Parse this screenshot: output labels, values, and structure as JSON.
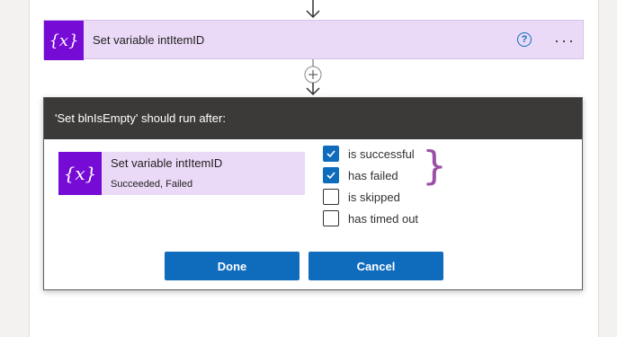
{
  "action_card": {
    "icon": "variable-icon",
    "icon_text": "{x}",
    "title": "Set variable intItemID",
    "help_icon": "question-circle-icon",
    "help_text": "?",
    "more_icon": "more-dots-icon",
    "more_text": "···"
  },
  "connector": {
    "icon": "add-step-icon"
  },
  "dialog": {
    "title": "'Set blnIsEmpty' should run after:",
    "previous_action": {
      "icon": "variable-icon",
      "icon_text": "{x}",
      "name": "Set variable intItemID",
      "status": "Succeeded, Failed"
    },
    "options": [
      {
        "label": "is successful",
        "checked": true
      },
      {
        "label": "has failed",
        "checked": true
      },
      {
        "label": "is skipped",
        "checked": false
      },
      {
        "label": "has timed out",
        "checked": false
      }
    ],
    "annotation": "}",
    "done_label": "Done",
    "cancel_label": "Cancel"
  },
  "colors": {
    "accent": "#0f6cbd",
    "variable_purple": "#770bd6",
    "card_background": "#eadaf7",
    "header_dark": "#3b3a39",
    "brace_annotation": "#9b4fa6"
  }
}
